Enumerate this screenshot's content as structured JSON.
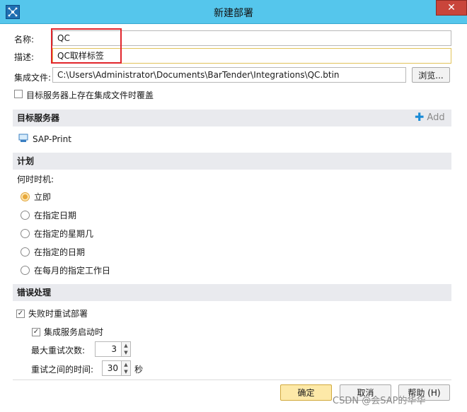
{
  "window": {
    "title": "新建部署",
    "close_label": "✕"
  },
  "form": {
    "name_label": "名称:",
    "name_value": "QC",
    "desc_label": "描述:",
    "desc_value": "QC取样标签",
    "file_label": "集成文件:",
    "file_value": "C:\\Users\\Administrator\\Documents\\BarTender\\Integrations\\QC.btin",
    "browse_label": "浏览...",
    "overwrite_label": "目标服务器上存在集成文件时覆盖",
    "overwrite_checked": false
  },
  "target": {
    "header": "目标服务器",
    "add_label": "Add",
    "server_name": "SAP-Print"
  },
  "schedule": {
    "header": "计划",
    "when_label": "何时时机:",
    "options": [
      {
        "label": "立即",
        "selected": true
      },
      {
        "label": "在指定日期",
        "selected": false
      },
      {
        "label": "在指定的星期几",
        "selected": false
      },
      {
        "label": "在指定的日期",
        "selected": false
      },
      {
        "label": "在每月的指定工作日",
        "selected": false
      }
    ]
  },
  "errors": {
    "header": "错误处理",
    "retry_label": "失败时重试部署",
    "retry_checked": true,
    "service_start_label": "集成服务启动时",
    "service_start_checked": true,
    "max_retries_label": "最大重试次数:",
    "max_retries_value": "3",
    "interval_label": "重试之间的时间:",
    "interval_value": "30",
    "interval_unit": "秒"
  },
  "footer": {
    "ok_label": "确定",
    "cancel_label": "取消",
    "help_label": "帮助 (H)"
  },
  "watermark": "CSDN @会SAP的华华",
  "colors": {
    "titlebar": "#55c6ec",
    "close": "#c9453b",
    "section_bg": "#e9eaee",
    "accent_add": "#1a8bd6",
    "highlight_box": "#e1252b",
    "primary_btn": "#fde9a8"
  }
}
